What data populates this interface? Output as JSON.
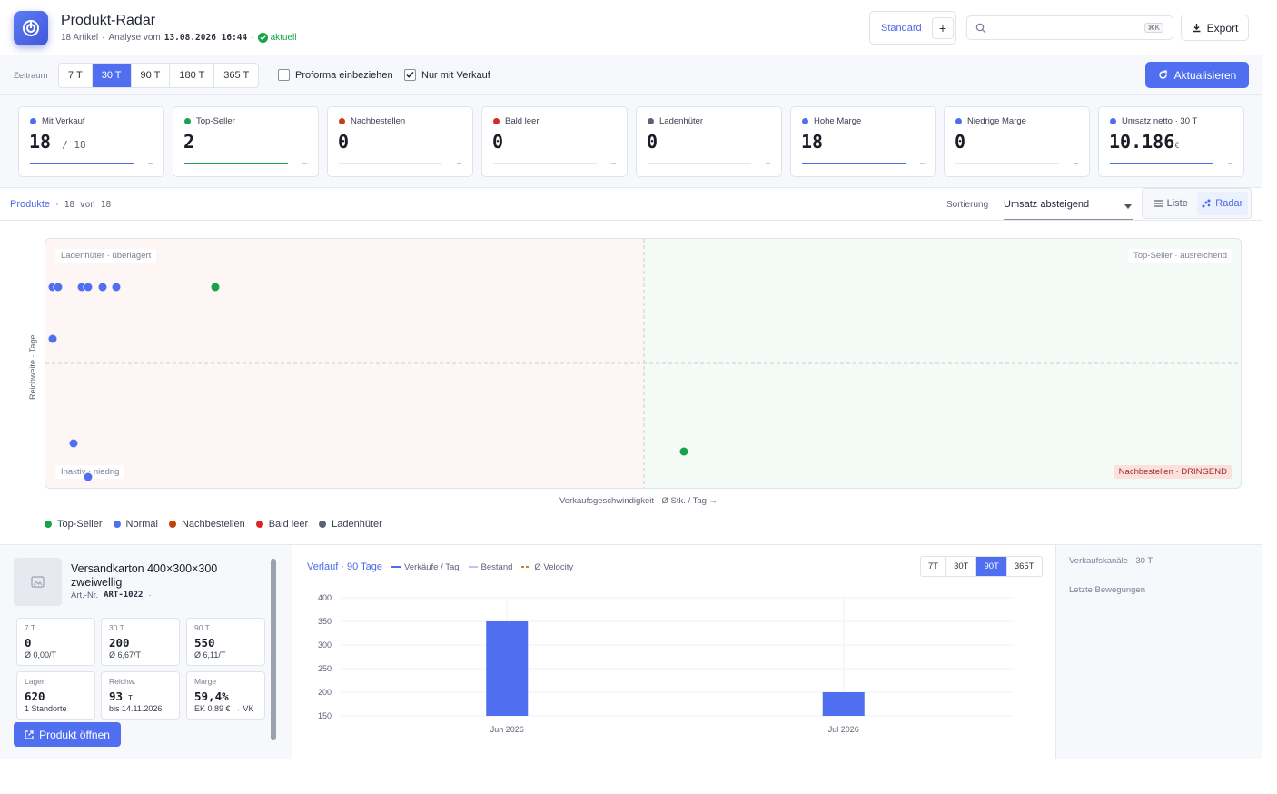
{
  "header": {
    "title": "Produkt-Radar",
    "count": "18 Artikel",
    "analysis_prefix": "Analyse vom",
    "analysis_ts": "13.08.2026 16:44",
    "status": "aktuell",
    "view": "Standard",
    "add": "+",
    "search_kbd": "⌘K",
    "export": "Export"
  },
  "toolbar": {
    "range_label": "Zeitraum",
    "ranges": [
      "7 T",
      "30 T",
      "90 T",
      "180 T",
      "365 T"
    ],
    "active_range": "30 T",
    "proforma": "Proforma einbeziehen",
    "only_sales": "Nur mit Verkauf",
    "refresh": "Aktualisieren"
  },
  "kpis": [
    {
      "label": "Mit Verkauf",
      "value": "18",
      "denom": "/ 18",
      "color": "#4f6ff0",
      "fill": 1
    },
    {
      "label": "Top-Seller",
      "value": "2",
      "color": "#16a34a",
      "fill": 1
    },
    {
      "label": "Nachbestellen",
      "value": "0",
      "color": "#c2410c",
      "fill": 0
    },
    {
      "label": "Bald leer",
      "value": "0",
      "color": "#dc2626",
      "fill": 0
    },
    {
      "label": "Ladenhüter",
      "value": "0",
      "color": "#5c6375",
      "fill": 0
    },
    {
      "label": "Hohe Marge",
      "value": "18",
      "color": "#4f6ff0",
      "fill": 1
    },
    {
      "label": "Niedrige Marge",
      "value": "0",
      "color": "#4f6ff0",
      "fill": 0
    },
    {
      "label": "Umsatz netto · 30 T",
      "value": "10.186",
      "unit": "€",
      "color": "#4f6ff0",
      "fill": 1
    }
  ],
  "kpi_tilde": "–",
  "products": {
    "label": "Produkte",
    "count": "18 von 18",
    "sort_label": "Sortierung",
    "sort_value": "Umsatz absteigend",
    "view_list": "Liste",
    "view_radar": "Radar"
  },
  "radar": {
    "q_tl": "Ladenhüter · überlagert",
    "q_tr": "Top-Seller · ausreichend",
    "q_bl": "Inaktiv · niedrig",
    "q_br": "Nachbestellen · DRINGEND",
    "y_label": "Reichweite · Tage",
    "x_label": "Verkaufsgeschwindigkeit · Ø Stk. / Tag →",
    "legend": [
      {
        "name": "Top-Seller",
        "color": "#16a34a"
      },
      {
        "name": "Normal",
        "color": "#4f6ff0"
      },
      {
        "name": "Nachbestellen",
        "color": "#c2410c"
      },
      {
        "name": "Bald leer",
        "color": "#dc2626"
      },
      {
        "name": "Ladenhüter",
        "color": "#5c6375"
      }
    ]
  },
  "detail": {
    "name": "Versandkarton 400×300×300 zweiwellig",
    "art_label": "Art.-Nr.",
    "art_no": "ART-1022",
    "dot": "·",
    "tiles": [
      {
        "t": "7 T",
        "v": "0",
        "s": "Ø 0,00/T"
      },
      {
        "t": "30 T",
        "v": "200",
        "s": "Ø 6,67/T"
      },
      {
        "t": "90 T",
        "v": "550",
        "s": "Ø 6,11/T"
      },
      {
        "t": "Lager",
        "v": "620",
        "s": "1 Standorte"
      },
      {
        "t": "Reichw.",
        "v": "93",
        "vu": "T",
        "s": "bis 14.11.2026"
      },
      {
        "t": "Marge",
        "v": "59,4%",
        "s": "EK 0,89 € → VK"
      }
    ],
    "open": "Produkt öffnen"
  },
  "chart_panel": {
    "title": "Verlauf · 90 Tage",
    "legend_sales": "Verkäufe / Tag",
    "legend_stock": "Bestand",
    "legend_velocity": "Ø Velocity",
    "ranges": [
      "7T",
      "30T",
      "90T",
      "365T"
    ],
    "active": "90T"
  },
  "side": {
    "channels": "Verkaufskanäle · 30 T",
    "moves": "Letzte Bewegungen"
  },
  "chart_data": {
    "type": "bar",
    "categories": [
      "Jun 2026",
      "Jul 2026"
    ],
    "series": [
      {
        "name": "Verkäufe / Tag",
        "values": [
          350,
          200
        ]
      }
    ],
    "ylim": [
      150,
      400
    ],
    "yticks": [
      400,
      350,
      300,
      250,
      200,
      150
    ],
    "grid": true
  }
}
